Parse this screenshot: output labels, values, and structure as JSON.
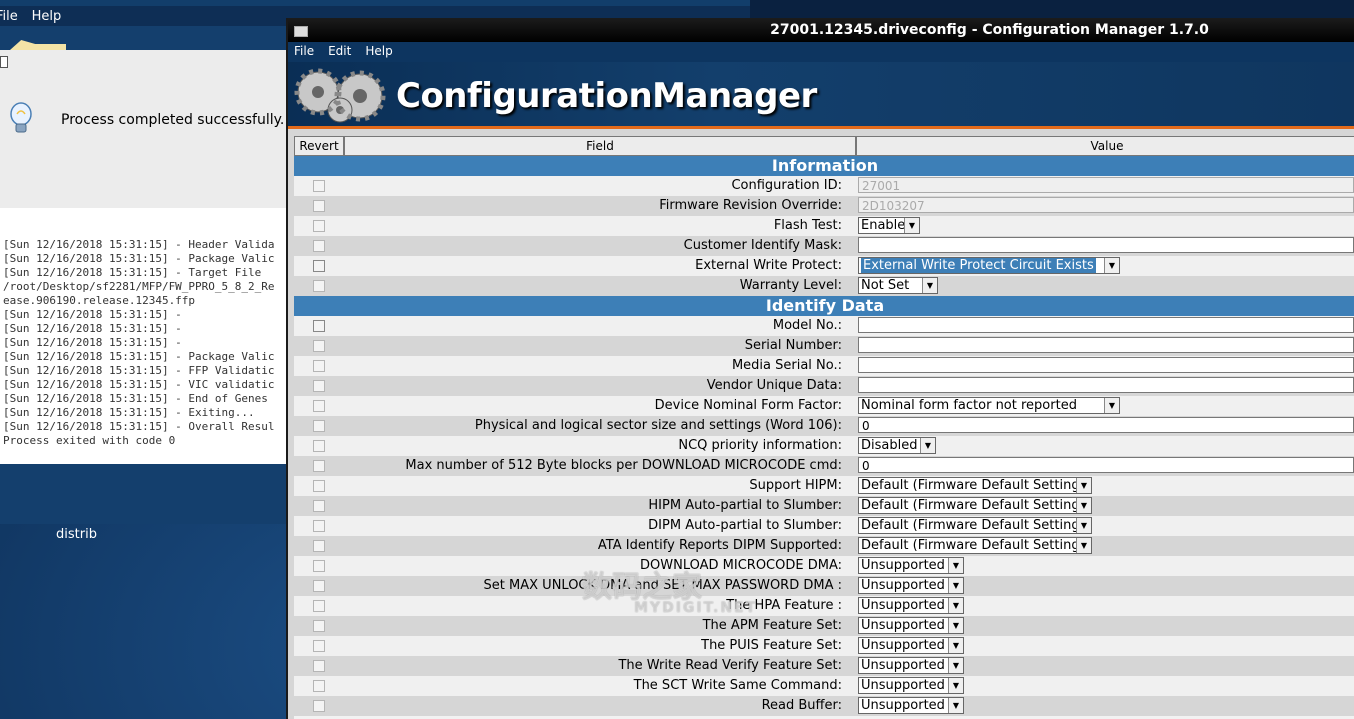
{
  "background_window": {
    "menu": [
      "File",
      "Help"
    ],
    "message": "Process completed successfully.",
    "log_lines": [
      "[Sun 12/16/2018 15:31:15] - Header Valida",
      "[Sun 12/16/2018 15:31:15] - Package Valic",
      "[Sun 12/16/2018 15:31:15] - Target File",
      "/root/Desktop/sf2281/MFP/FW_PPRO_5_8_2_Re",
      "ease.906190.release.12345.ffp",
      "[Sun 12/16/2018 15:31:15] -",
      "[Sun 12/16/2018 15:31:15] -",
      "[Sun 12/16/2018 15:31:15] -",
      "[Sun 12/16/2018 15:31:15] - Package Valic",
      "[Sun 12/16/2018 15:31:15] - FFP Validatic",
      "[Sun 12/16/2018 15:31:15] - VIC validatic",
      "[Sun 12/16/2018 15:31:15] - End of Genes",
      "[Sun 12/16/2018 15:31:15] - Exiting...",
      "[Sun 12/16/2018 15:31:15] - Overall Resul"
    ],
    "exit_text": "Process exited with code 0"
  },
  "desktop": {
    "label": "distrib"
  },
  "window": {
    "title": "27001.12345.driveconfig - Configuration Manager 1.7.0",
    "menu": [
      "File",
      "Edit",
      "Help"
    ],
    "banner_title": "ConfigurationManager"
  },
  "table": {
    "headers": {
      "revert": "Revert",
      "field": "Field",
      "value": "Value"
    },
    "sections": {
      "information": "Information",
      "identify": "Identify Data"
    },
    "rows": [
      {
        "label": "Configuration ID:",
        "kind": "text",
        "value": "27001",
        "disabled": true
      },
      {
        "label": "Firmware Revision Override:",
        "kind": "text",
        "value": "2D103207",
        "disabled": true
      },
      {
        "label": "Flash Test:",
        "kind": "select",
        "value": "Enable"
      },
      {
        "label": "Customer Identify Mask:",
        "kind": "text",
        "value": ""
      },
      {
        "label": "External Write Protect:",
        "kind": "select",
        "value": "External Write Protect Circuit Exists",
        "highlight": true
      },
      {
        "label": "Warranty Level:",
        "kind": "select",
        "value": "Not Set"
      },
      {
        "label": "Model No.:",
        "kind": "text",
        "value": ""
      },
      {
        "label": "Serial Number:",
        "kind": "text",
        "value": ""
      },
      {
        "label": "Media Serial No.:",
        "kind": "text",
        "value": ""
      },
      {
        "label": "Vendor Unique Data:",
        "kind": "text",
        "value": ""
      },
      {
        "label": "Device Nominal Form Factor:",
        "kind": "select",
        "value": "Nominal form factor not reported"
      },
      {
        "label": "Physical and logical sector size and settings (Word 106):",
        "kind": "text",
        "value": "0"
      },
      {
        "label": "NCQ priority information:",
        "kind": "select",
        "value": "Disabled"
      },
      {
        "label": "Max number of 512 Byte blocks per DOWNLOAD MICROCODE cmd:",
        "kind": "text",
        "value": "0"
      },
      {
        "label": "Support HIPM:",
        "kind": "select",
        "value": "Default (Firmware Default Setting)"
      },
      {
        "label": "HIPM Auto-partial to Slumber:",
        "kind": "select",
        "value": "Default (Firmware Default Setting)"
      },
      {
        "label": "DIPM Auto-partial to Slumber:",
        "kind": "select",
        "value": "Default (Firmware Default Setting)"
      },
      {
        "label": "ATA Identify Reports DIPM Supported:",
        "kind": "select",
        "value": "Default (Firmware Default Setting)"
      },
      {
        "label": "DOWNLOAD MICROCODE DMA:",
        "kind": "select",
        "value": "Unsupported"
      },
      {
        "label": "Set MAX UNLOCK DMA and SET MAX PASSWORD DMA :",
        "kind": "select",
        "value": "Unsupported"
      },
      {
        "label": "The HPA Feature :",
        "kind": "select",
        "value": "Unsupported"
      },
      {
        "label": "The APM Feature Set:",
        "kind": "select",
        "value": "Unsupported"
      },
      {
        "label": "The PUIS Feature Set:",
        "kind": "select",
        "value": "Unsupported"
      },
      {
        "label": "The Write Read Verify Feature Set:",
        "kind": "select",
        "value": "Unsupported"
      },
      {
        "label": "The SCT Write Same Command:",
        "kind": "select",
        "value": "Unsupported"
      },
      {
        "label": "Read Buffer:",
        "kind": "select",
        "value": "Unsupported"
      }
    ]
  },
  "watermark": {
    "main": "数码之家",
    "sub": "MYDIGIT.NET"
  }
}
